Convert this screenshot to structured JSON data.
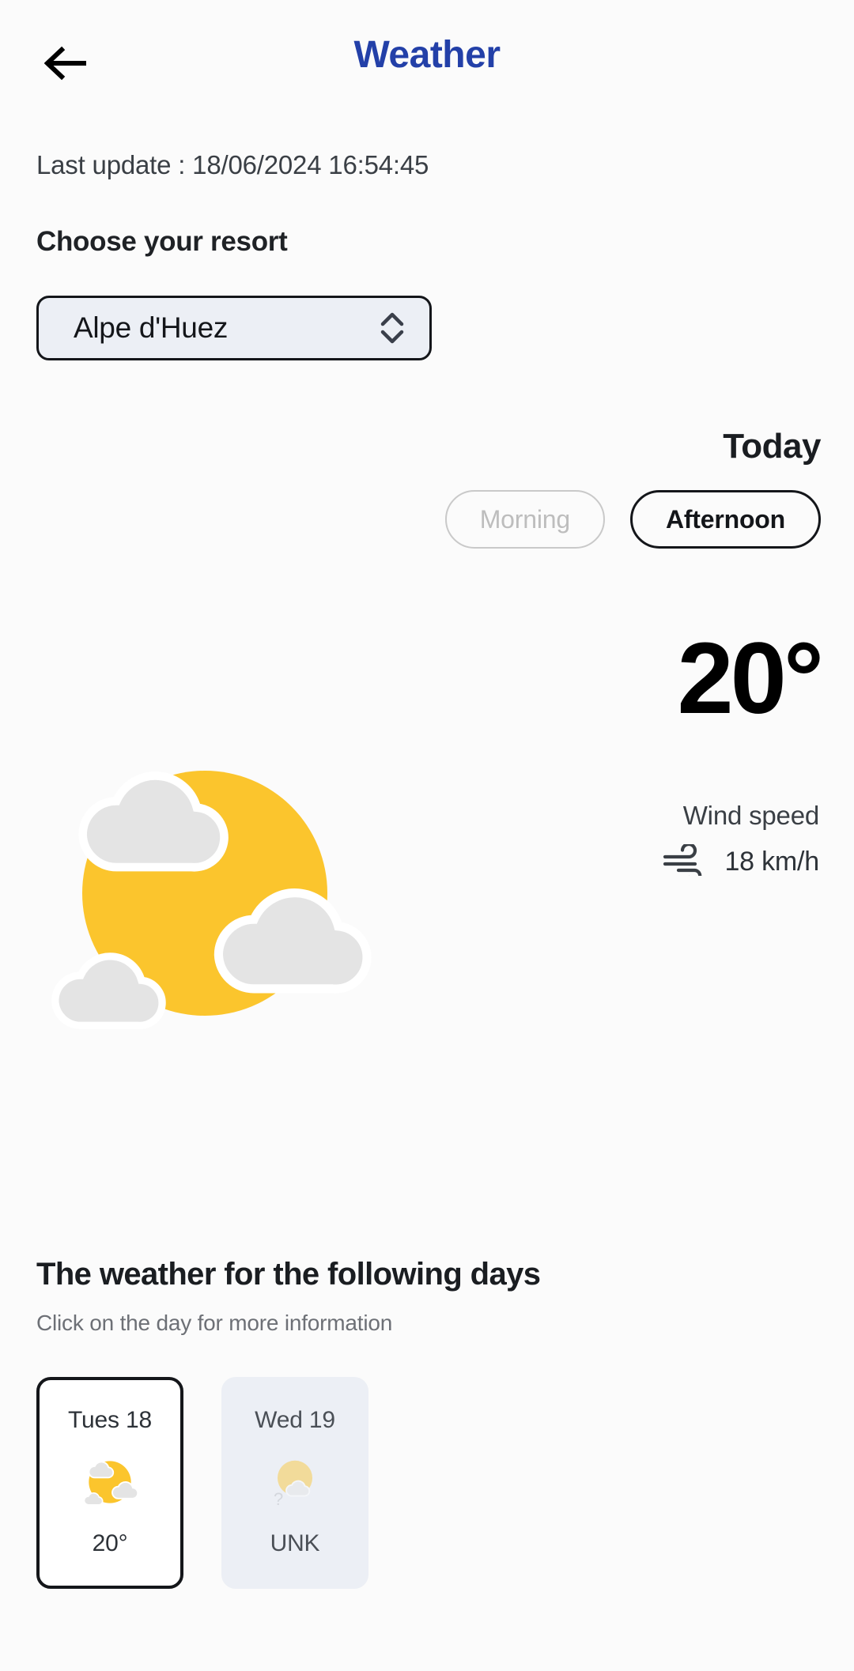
{
  "header": {
    "title": "Weather",
    "back_icon": "arrow-left-icon"
  },
  "status": {
    "last_update": "Last update : 18/06/2024 16:54:45"
  },
  "resort": {
    "label": "Choose your resort",
    "selected": "Alpe d'Huez",
    "stepper_icon": "chevron-up-down-icon"
  },
  "today": {
    "heading": "Today",
    "periods": [
      {
        "label": "Morning",
        "state": "disabled"
      },
      {
        "label": "Afternoon",
        "state": "active"
      }
    ],
    "temperature": "20°",
    "wind_label": "Wind speed",
    "wind_icon": "wind-icon",
    "wind_value": "18 km/h",
    "condition_icon": "sun-behind-clouds-icon"
  },
  "following": {
    "title": "The weather for the following days",
    "subtitle": "Click on the day for more information",
    "days": [
      {
        "name": "Tues 18",
        "icon": "sun-behind-clouds-icon",
        "temp": "20°",
        "state": "selected"
      },
      {
        "name": "Wed 19",
        "icon": "unknown-weather-icon",
        "temp": "UNK",
        "state": "muted"
      }
    ]
  },
  "colors": {
    "brand_blue": "#2340a8",
    "sun_yellow": "#FBC52D",
    "cloud_gray": "#E4E4E4",
    "surface": "#eceff5",
    "ink": "#14161a"
  }
}
